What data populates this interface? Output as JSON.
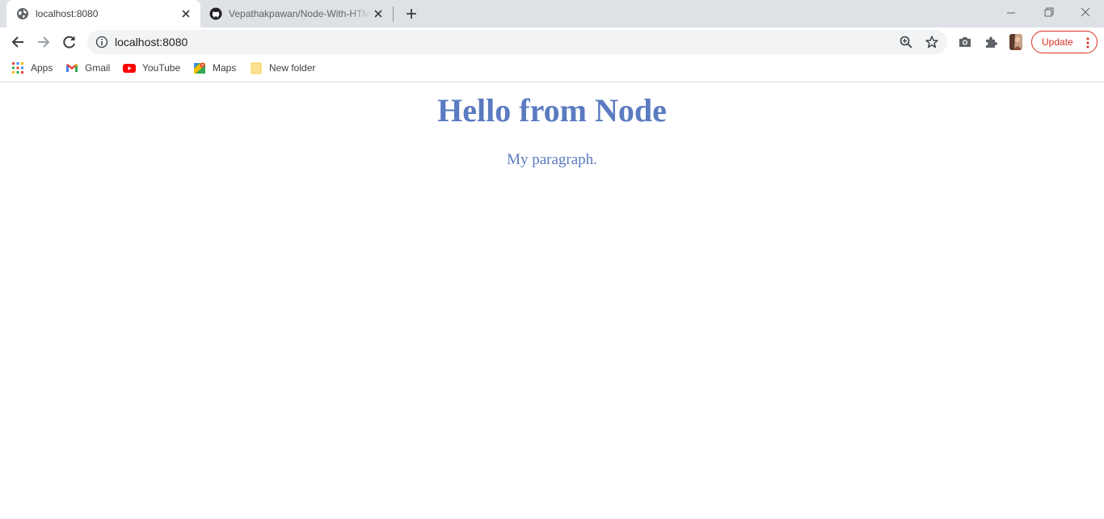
{
  "tabs": [
    {
      "title": "localhost:8080",
      "icon": "globe-icon",
      "active": true
    },
    {
      "title": "Vepathakpawan/Node-With-HTML",
      "icon": "github-icon",
      "active": false
    }
  ],
  "omnibox": {
    "url": "localhost:8080"
  },
  "toolbar": {
    "update_label": "Update"
  },
  "bookmarks": [
    {
      "label": "Apps",
      "icon": "apps-grid-icon"
    },
    {
      "label": "Gmail",
      "icon": "gmail-icon"
    },
    {
      "label": "YouTube",
      "icon": "youtube-icon"
    },
    {
      "label": "Maps",
      "icon": "maps-icon"
    },
    {
      "label": "New folder",
      "icon": "folder-icon"
    }
  ],
  "content": {
    "heading": "Hello from Node",
    "paragraph": "My paragraph.",
    "text_color": "#5b7bc1"
  },
  "colors": {
    "tabstrip_bg": "#dee1e6",
    "update_accent": "#d93025"
  }
}
